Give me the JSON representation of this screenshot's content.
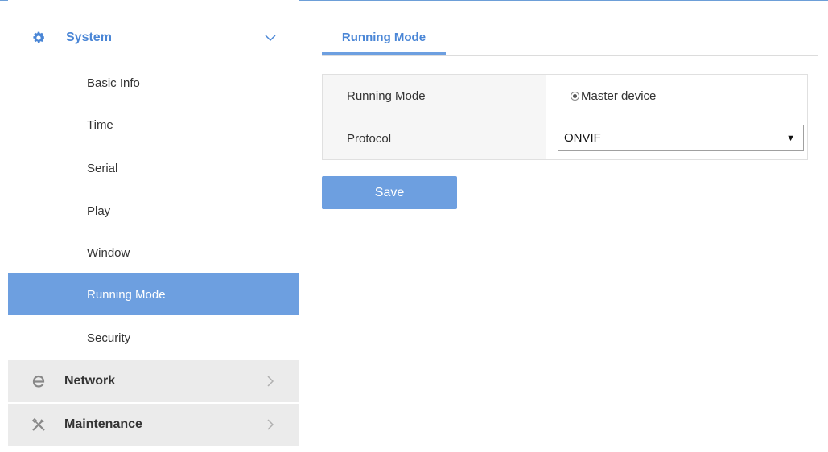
{
  "sidebar": {
    "system": {
      "label": "System",
      "icon": "gear-icon",
      "chevron": "chevron-down-icon"
    },
    "items": [
      {
        "label": "Basic Info"
      },
      {
        "label": "Time"
      },
      {
        "label": "Serial"
      },
      {
        "label": "Play"
      },
      {
        "label": "Window"
      },
      {
        "label": "Running Mode",
        "active": true
      },
      {
        "label": "Security"
      }
    ],
    "network": {
      "label": "Network",
      "icon": "network-e-icon",
      "chevron": "chevron-right-icon"
    },
    "maintenance": {
      "label": "Maintenance",
      "icon": "tools-icon",
      "chevron": "chevron-right-icon"
    }
  },
  "main": {
    "tab": {
      "label": "Running Mode"
    },
    "form": {
      "running_mode": {
        "label": "Running Mode",
        "option": "Master device",
        "selected": true
      },
      "protocol": {
        "label": "Protocol",
        "value": "ONVIF",
        "arrow": "▼"
      }
    },
    "save_label": "Save"
  },
  "colors": {
    "accent": "#6d9fe0",
    "accent_text": "#4a86d6",
    "sidebar_collapsed_bg": "#ebebeb",
    "label_cell_bg": "#f6f6f6"
  }
}
